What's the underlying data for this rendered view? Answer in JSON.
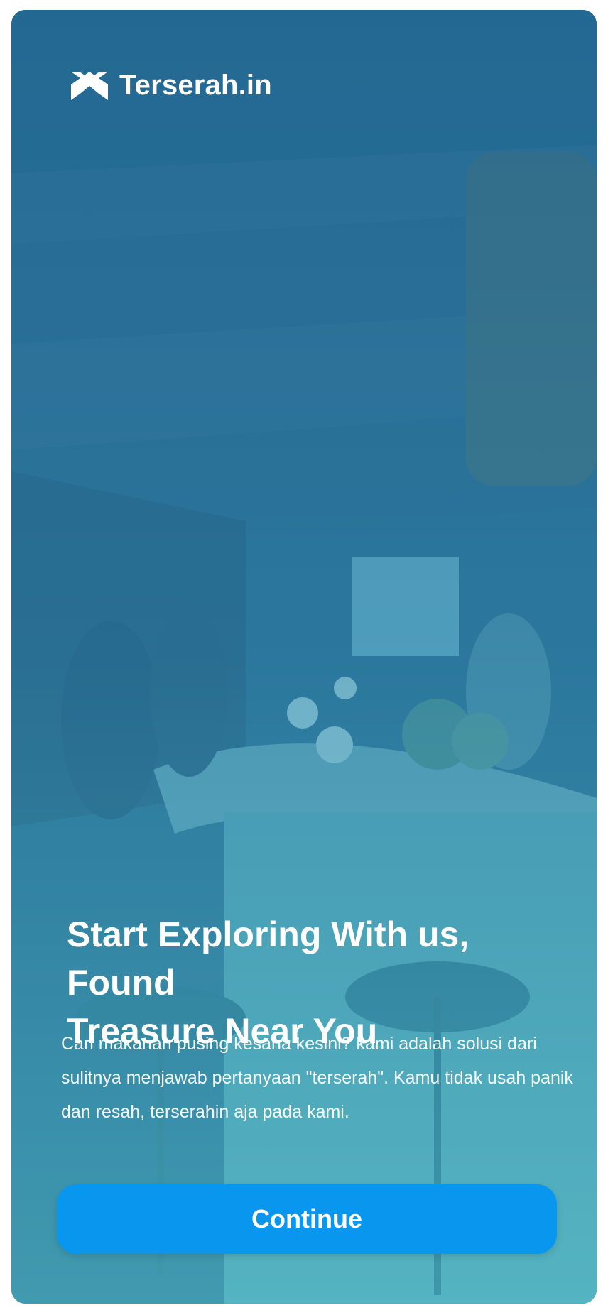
{
  "header": {
    "brand": "Terserah.in",
    "logo_icon": "chevron-house-logo-icon"
  },
  "onboarding": {
    "headline_line1": "Start Exploring With us, Found",
    "headline_line2": "Treasure Near You",
    "description": "Cari makanan pusing kesana kesini? kami adalah solusi dari sulitnya menjawab pertanyaan \"terserah\". Kamu tidak usah panik dan resah, terserahin aja pada kami.",
    "button_label": "Continue"
  },
  "colors": {
    "accent": "#0896ef",
    "overlay": "#2f7fa8",
    "text": "#ffffff"
  }
}
